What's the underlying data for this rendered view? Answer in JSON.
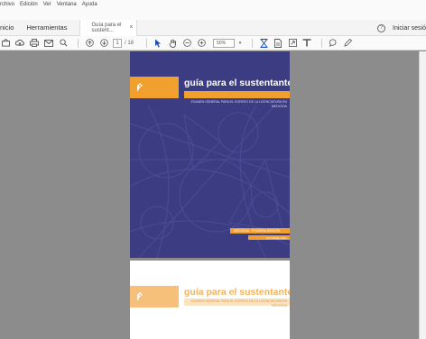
{
  "menu": {
    "items": [
      "rchivo",
      "Edición",
      "Ver",
      "Ventana",
      "Ayuda"
    ]
  },
  "tabs": {
    "home": "nicio",
    "tools": "Herramientas",
    "document": "Guía para el sustent...",
    "close": "×",
    "help": "?",
    "signin": "Iniciar sesió"
  },
  "toolbar": {
    "page_current": "1",
    "page_total": "/ 18",
    "zoom": "50%"
  },
  "document": {
    "title": "guía para el sustentante",
    "subtitle": "EXAMEN GENERAL PARA EL EGRESO DE LA LICENCIATURA EN MEDICINA",
    "band1": "MEDICINA · PRIMERA EDICIÓN",
    "band2": "OCTUBRE 2019",
    "page2_title": "guía para el sustentante",
    "page2_subtitle": "EXAMEN GENERAL PARA EL EGRESO DE LA LICENCIATURA EN MEDICINA"
  },
  "colors": {
    "cover_blue": "#3c3c82",
    "accent_orange": "#f2a02d",
    "workspace_gray": "#8c8c8c"
  },
  "icons": [
    "home-icon",
    "cloud-upload-icon",
    "print-icon",
    "mail-icon",
    "search-icon",
    "arrow-up-circle-icon",
    "arrow-down-circle-icon",
    "cursor-icon",
    "hand-icon",
    "zoom-out-icon",
    "zoom-in-icon",
    "fit-page-icon",
    "page-icon",
    "fullscreen-icon",
    "annotate-icon",
    "comment-icon",
    "pen-icon"
  ]
}
